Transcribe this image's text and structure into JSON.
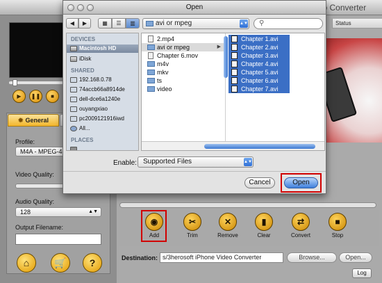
{
  "app": {
    "title_partial": "iPhone Video Converter",
    "status_header": "Status",
    "tabs": {
      "general": "General"
    },
    "profile_label": "Profile:",
    "profile_value": "M4A - MPEG-4",
    "video_quality_label": "Video Quality:",
    "audio_quality_label": "Audio Quality:",
    "audio_quality_value": "128",
    "output_filename_label": "Output Filename:",
    "toolbar": {
      "add": "Add",
      "trim": "Trim",
      "remove": "Remove",
      "clear": "Clear",
      "convert": "Convert",
      "stop": "Stop"
    },
    "destination_label": "Destination:",
    "destination_value": "s/3herosoft iPhone Video Converter",
    "browse_label": "Browse...",
    "open_label": "Open...",
    "log_label": "Log"
  },
  "dialog": {
    "title": "Open",
    "current_folder": "avi or mpeg",
    "sidebar": {
      "devices_header": "DEVICES",
      "devices": [
        "Macintosh HD",
        "iDisk"
      ],
      "shared_header": "SHARED",
      "shared": [
        "192.168.0.78",
        "74accb66a8914de",
        "dell-dce6a1240e",
        "ouyangxiao",
        "pc2009121916iwd",
        "All..."
      ],
      "places_header": "PLACES"
    },
    "column1": [
      "2.mp4",
      "avi or mpeg",
      "Chapter 6.mov",
      "m4v",
      "mkv",
      "ts",
      "video"
    ],
    "column2": [
      "Chapter 1.avi",
      "Chapter 2.avi",
      "Chapter 3.avi",
      "Chapter 4.avi",
      "Chapter 5.avi",
      "Chapter 6.avi",
      "Chapter 7.avi"
    ],
    "enable_label": "Enable:",
    "enable_value": "Supported Files",
    "cancel_label": "Cancel",
    "open_label": "Open"
  }
}
